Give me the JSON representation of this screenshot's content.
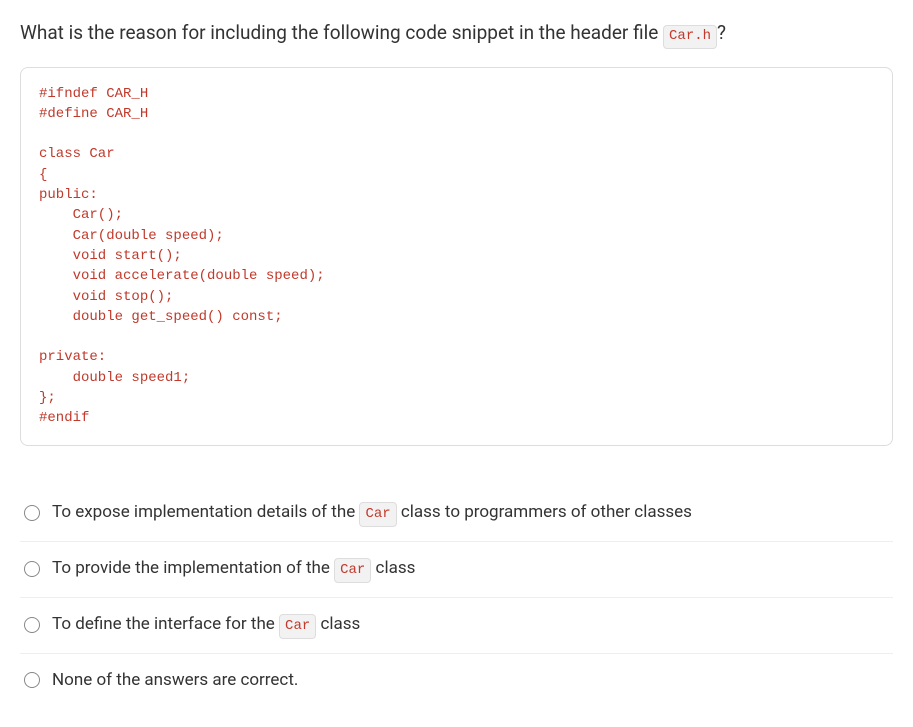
{
  "question": {
    "prefix": "What is the reason for including the following code snippet in the header file ",
    "filename": "Car.h",
    "suffix": "?"
  },
  "code": "#ifndef CAR_H\n#define CAR_H\n\nclass Car\n{\npublic:\n    Car();\n    Car(double speed);\n    void start();\n    void accelerate(double speed);\n    void stop();\n    double get_speed() const;\n\nprivate:\n    double speed1;\n};\n#endif",
  "options": [
    {
      "pre": "To expose implementation details of the ",
      "code": "Car",
      "post": " class to programmers of other classes"
    },
    {
      "pre": "To provide the implementation of the ",
      "code": "Car",
      "post": " class"
    },
    {
      "pre": "To define the interface for the ",
      "code": "Car",
      "post": " class"
    },
    {
      "pre": "None of the answers are correct.",
      "code": null,
      "post": ""
    }
  ]
}
